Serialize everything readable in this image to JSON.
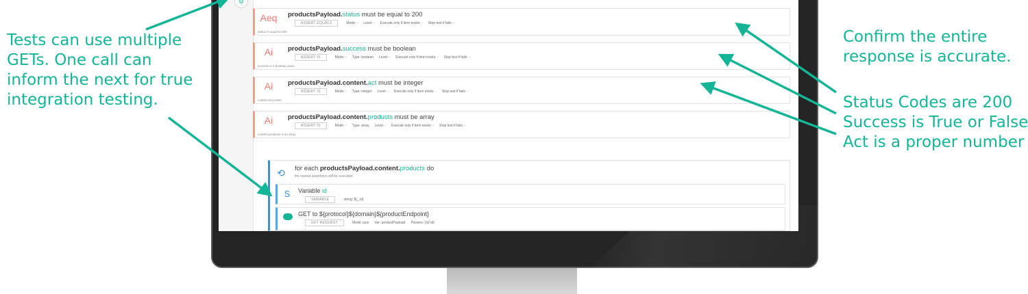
{
  "annotations": {
    "left": [
      "Tests can use multiple",
      "GETs. One call can",
      "inform the next for true",
      "integration testing."
    ],
    "confirm": [
      "Confirm the entire",
      "response is accurate."
    ],
    "status": [
      "Status Codes are 200",
      "Success is True or False",
      "Act is a proper number"
    ]
  },
  "colors": {
    "accent": "#14b596",
    "assert": "#ef7c70",
    "loop": "#3d90d6"
  },
  "assertions": [
    {
      "badge": "Aeq",
      "prefix": "productsPayload.",
      "field": "status",
      "suffix": " must be equal to 200",
      "tag": "ASSERT EQUALS",
      "mode": "Mode: -",
      "type": "",
      "level": "Level: -",
      "exec": "Execute only if item exists: -",
      "stop": "Stop test if fails: -",
      "note": "status is equal to 200"
    },
    {
      "badge": "Ai",
      "prefix": "productsPayload.",
      "field": "success",
      "suffix": " must be boolean",
      "tag": "ASSERT IS",
      "mode": "Mode: -",
      "type": "Type: boolean",
      "level": "Level: -",
      "exec": "Execute only if item exists: -",
      "stop": "Stop test if fails: -",
      "note": "success is a boolean value"
    },
    {
      "badge": "Ai",
      "prefix": "productsPayload.content.",
      "field": "act",
      "suffix": " must be integer",
      "tag": "ASSERT IS",
      "mode": "Mode: -",
      "type": "Type: integer",
      "level": "Level: -",
      "exec": "Execute only if item exists: -",
      "stop": "Stop test if fails: -",
      "note": "content.act exists"
    },
    {
      "badge": "Ai",
      "prefix": "productsPayload.content.",
      "field": "products",
      "suffix": " must be array",
      "tag": "ASSERT IS",
      "mode": "Mode: -",
      "type": "Type: array",
      "level": "Level: -",
      "exec": "Execute only if item exists: -",
      "stop": "Stop test if fails: -",
      "note": "content.products is an array"
    }
  ],
  "loop": {
    "prefix": "for each ",
    "path": "productsPayload.content.",
    "field": "products",
    "suffix": " do",
    "sub": "the nested assertions will be executed"
  },
  "variable": {
    "badge": "S",
    "label": "Variable ",
    "name": "id",
    "tag": "VARIABLE",
    "value": "string: ${_.id}"
  },
  "get_request": {
    "title": "GET to ${protocol}${domain}${productEndpoint}",
    "tag": "GET REQUEST",
    "mode": "Mode: json",
    "var": "Var: productPayload",
    "params": "Params: {'id':id}"
  }
}
